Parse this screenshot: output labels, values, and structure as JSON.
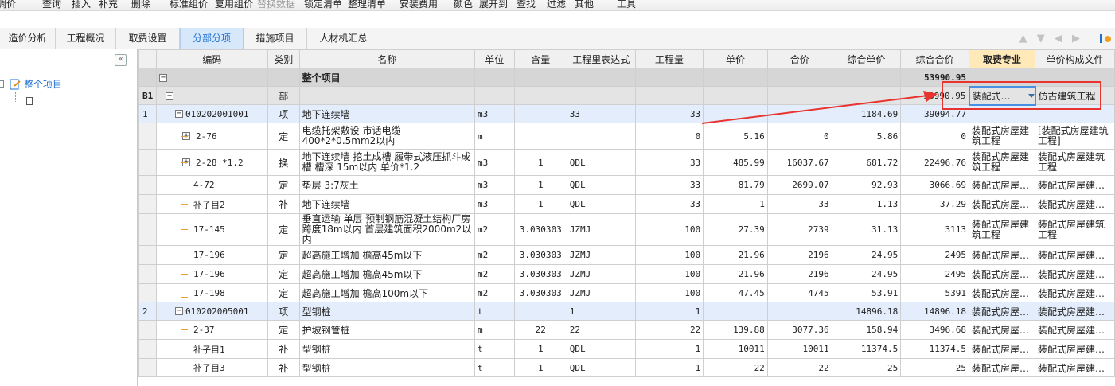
{
  "toolbar": {
    "items": [
      "调价",
      "查询",
      "插入",
      "补充",
      "删除",
      "标准组价",
      "复用组价",
      "替换数据",
      "锁定清单",
      "整理清单",
      "安装费用",
      "颜色",
      "展开到",
      "查找",
      "过滤",
      "其他",
      "工具"
    ]
  },
  "tabs": [
    "造价分析",
    "工程概况",
    "取费设置",
    "分部分项",
    "措施项目",
    "人材机汇总"
  ],
  "active_tab": "分部分项",
  "sidebar": {
    "collapse_glyph": "«",
    "root_label": "整个项目"
  },
  "columns": [
    "编码",
    "类别",
    "名称",
    "单位",
    "含量",
    "工程里表达式",
    "工程量",
    "单价",
    "合价",
    "综合单价",
    "综合合价",
    "取费专业",
    "单价构成文件"
  ],
  "row_total": {
    "name": "整个项目",
    "total": "53990.95"
  },
  "row_section": {
    "rn": "B1",
    "type": "部",
    "total": "53990.95",
    "fee_select": "装配式…",
    "composition": "仿古建筑工程"
  },
  "rows": [
    {
      "rn": "1",
      "code": "010202001001",
      "type": "项",
      "name": "地下连续墙",
      "unit": "m3",
      "content": "",
      "expr": "33",
      "qty": "33",
      "price": "",
      "amount": "",
      "uprice": "1184.69",
      "utotal": "39094.77",
      "fee": "",
      "comp": ""
    },
    {
      "rn": "",
      "code": "2-76",
      "type": "定",
      "name": "电缆托架敷设 市话电缆400*2*0.5mm2以内",
      "unit": "m",
      "content": "",
      "expr": "",
      "qty": "0",
      "price": "5.16",
      "amount": "0",
      "uprice": "5.86",
      "utotal": "0",
      "fee": "装配式房屋建筑工程",
      "comp": "[装配式房屋建筑工程]"
    },
    {
      "rn": "",
      "code": "2-28 *1.2",
      "type": "换",
      "name": "地下连续墙 挖土成槽 履带式液压抓斗成槽 槽深 15m以内  单价*1.2",
      "unit": "m3",
      "content": "1",
      "expr": "QDL",
      "qty": "33",
      "price": "485.99",
      "amount": "16037.67",
      "uprice": "681.72",
      "utotal": "22496.76",
      "fee": "装配式房屋建筑工程",
      "comp": "装配式房屋建筑工程"
    },
    {
      "rn": "",
      "code": "4-72",
      "type": "定",
      "name": "垫层 3:7灰土",
      "unit": "m3",
      "content": "1",
      "expr": "QDL",
      "qty": "33",
      "price": "81.79",
      "amount": "2699.07",
      "uprice": "92.93",
      "utotal": "3066.69",
      "fee": "装配式房屋…",
      "comp": "装配式房屋建…"
    },
    {
      "rn": "",
      "code": "补子目2",
      "type": "补",
      "name": "地下连续墙",
      "unit": "m3",
      "content": "1",
      "expr": "QDL",
      "qty": "33",
      "price": "1",
      "amount": "33",
      "uprice": "1.13",
      "utotal": "37.29",
      "fee": "装配式房屋…",
      "comp": "装配式房屋建…"
    },
    {
      "rn": "",
      "code": "17-145",
      "type": "定",
      "name": "垂直运输 单层 预制钢筋混凝土结构厂房 跨度18m以内 首层建筑面积2000m2以内",
      "unit": "m2",
      "content": "3.030303",
      "expr": "JZMJ",
      "qty": "100",
      "price": "27.39",
      "amount": "2739",
      "uprice": "31.13",
      "utotal": "3113",
      "fee": "装配式房屋建筑工程",
      "comp": "装配式房屋建筑工程"
    },
    {
      "rn": "",
      "code": "17-196",
      "type": "定",
      "name": "超高施工增加 檐高45m以下",
      "unit": "m2",
      "content": "3.030303",
      "expr": "JZMJ",
      "qty": "100",
      "price": "21.96",
      "amount": "2196",
      "uprice": "24.95",
      "utotal": "2495",
      "fee": "装配式房屋…",
      "comp": "装配式房屋建…"
    },
    {
      "rn": "",
      "code": "17-196",
      "type": "定",
      "name": "超高施工增加 檐高45m以下",
      "unit": "m2",
      "content": "3.030303",
      "expr": "JZMJ",
      "qty": "100",
      "price": "21.96",
      "amount": "2196",
      "uprice": "24.95",
      "utotal": "2495",
      "fee": "装配式房屋…",
      "comp": "装配式房屋建…"
    },
    {
      "rn": "",
      "code": "17-198",
      "type": "定",
      "name": "超高施工增加 檐高100m以下",
      "unit": "m2",
      "content": "3.030303",
      "expr": "JZMJ",
      "qty": "100",
      "price": "47.45",
      "amount": "4745",
      "uprice": "53.91",
      "utotal": "5391",
      "fee": "装配式房屋…",
      "comp": "装配式房屋建…"
    },
    {
      "rn": "2",
      "code": "010202005001",
      "type": "项",
      "name": "型钢桩",
      "unit": "t",
      "content": "",
      "expr": "1",
      "qty": "1",
      "price": "",
      "amount": "",
      "uprice": "14896.18",
      "utotal": "14896.18",
      "fee": "装配式房屋…",
      "comp": "装配式房屋建…"
    },
    {
      "rn": "",
      "code": "2-37",
      "type": "定",
      "name": "护坡钢管桩",
      "unit": "m",
      "content": "22",
      "expr": "22",
      "qty": "22",
      "price": "139.88",
      "amount": "3077.36",
      "uprice": "158.94",
      "utotal": "3496.68",
      "fee": "装配式房屋…",
      "comp": "装配式房屋建…"
    },
    {
      "rn": "",
      "code": "补子目1",
      "type": "补",
      "name": "型钢桩",
      "unit": "t",
      "content": "1",
      "expr": "QDL",
      "qty": "1",
      "price": "10011",
      "amount": "10011",
      "uprice": "11374.5",
      "utotal": "11374.5",
      "fee": "装配式房屋…",
      "comp": "装配式房屋建…"
    },
    {
      "rn": "",
      "code": "补子目3",
      "type": "补",
      "name": "型钢桩",
      "unit": "t",
      "content": "1",
      "expr": "QDL",
      "qty": "1",
      "price": "22",
      "amount": "22",
      "uprice": "25",
      "utotal": "25",
      "fee": "装配式房屋…",
      "comp": "装配式房屋建…"
    }
  ],
  "colors": {
    "accent": "#1f6fd0",
    "highlight_header": "#ffe9b8",
    "annotation_red": "#e8332f"
  }
}
